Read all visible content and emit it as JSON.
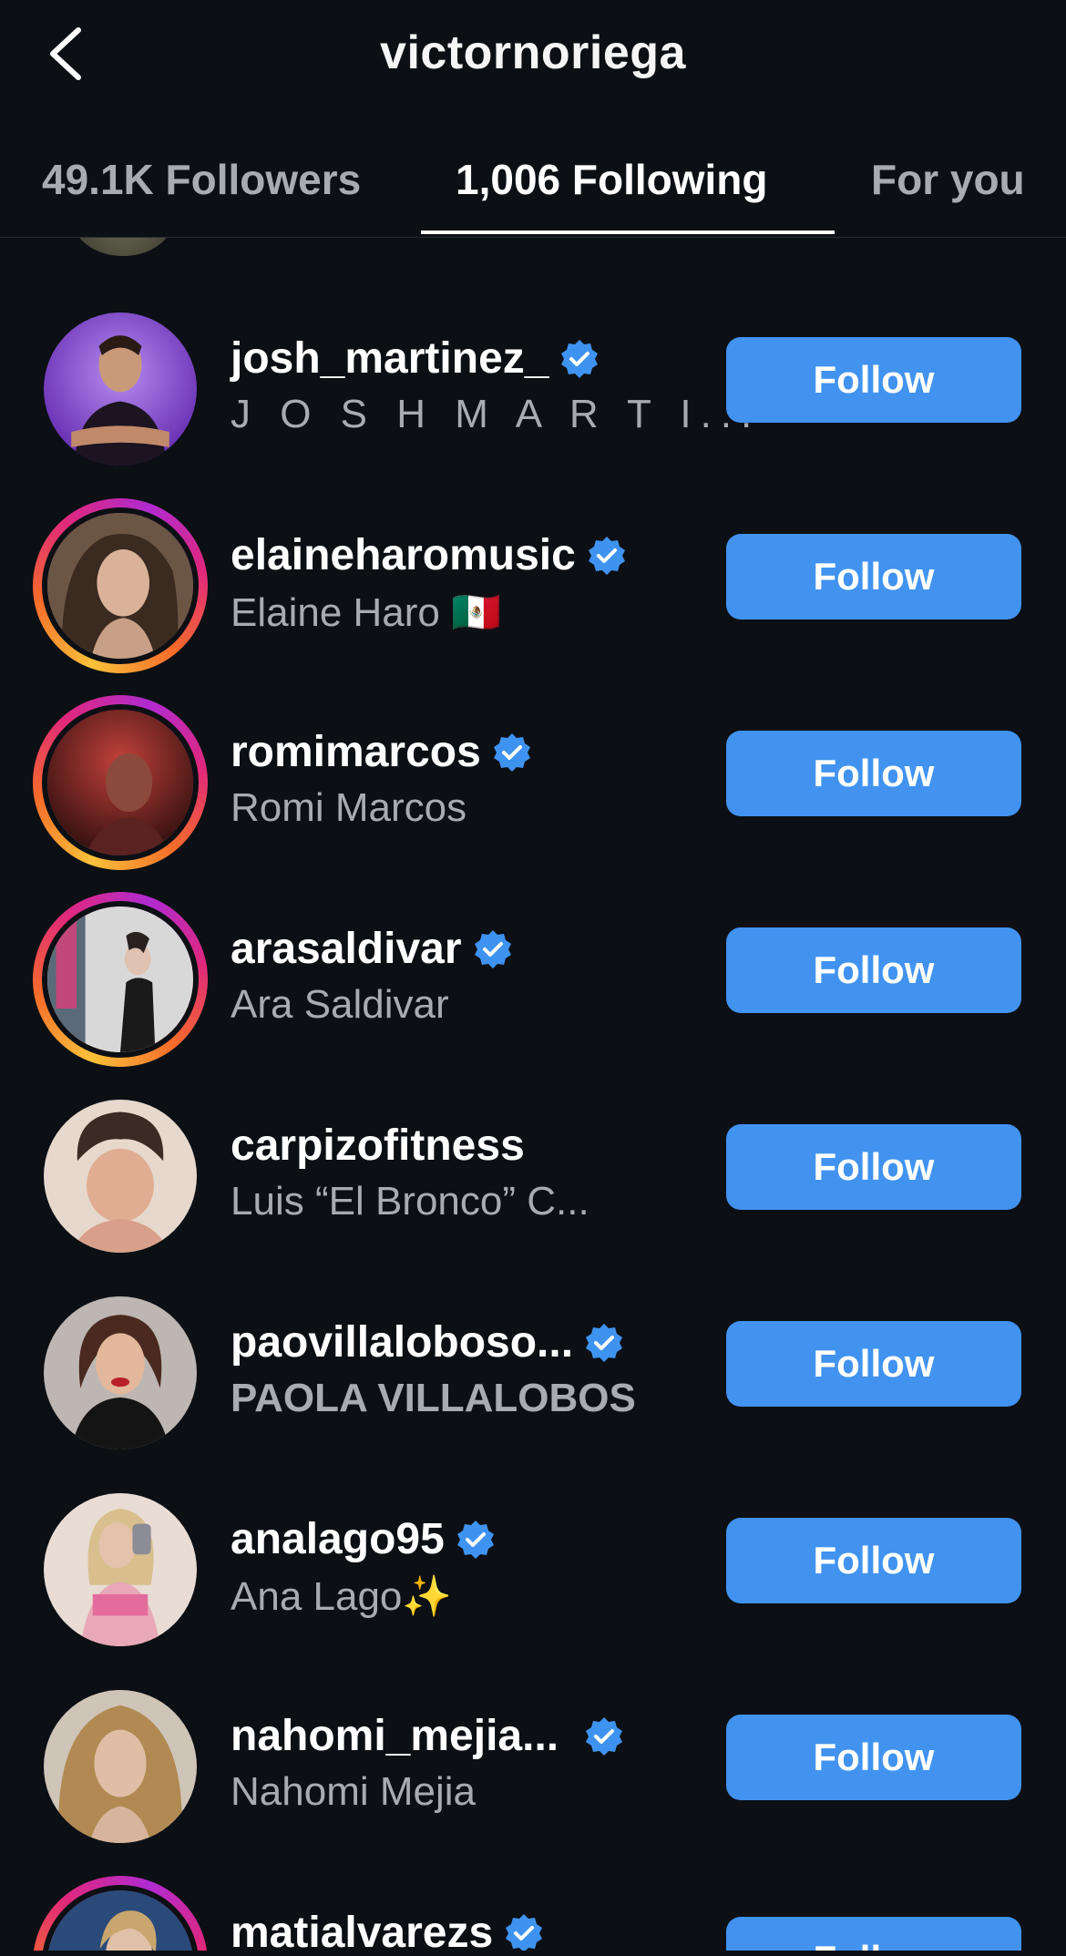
{
  "header": {
    "title": "victornoriega",
    "back_icon": "chevron-left-icon"
  },
  "tabs": [
    {
      "label": "49.1K Followers",
      "active": false
    },
    {
      "label": "1,006 Following",
      "active": true
    },
    {
      "label": "For you",
      "active": false
    }
  ],
  "colors": {
    "background": "#0c0f14",
    "button": "#4193ef",
    "verified": "#3f93f0",
    "secondary_text": "#a8abb1"
  },
  "users": [
    {
      "username": "josh_martinez_",
      "full_name": "J O S H  M A R T I...",
      "verified": true,
      "follow_label": "Follow"
    },
    {
      "username": "elaineharomusic",
      "full_name": "Elaine Haro 🇲🇽",
      "verified": true,
      "follow_label": "Follow"
    },
    {
      "username": "romimarcos",
      "full_name": "Romi Marcos",
      "verified": true,
      "follow_label": "Follow"
    },
    {
      "username": "arasaldivar",
      "full_name": "Ara Saldivar",
      "verified": true,
      "follow_label": "Follow"
    },
    {
      "username": "carpizofitness",
      "full_name": "Luis “El Bronco” C...",
      "verified": false,
      "follow_label": "Follow"
    },
    {
      "username": "paovillaloboso...",
      "full_name": "PAOLA VILLALOBOS",
      "verified": true,
      "follow_label": "Follow"
    },
    {
      "username": "analago95",
      "full_name": "Ana Lago✨",
      "verified": true,
      "follow_label": "Follow"
    },
    {
      "username": "nahomi_mejia...",
      "full_name": "Nahomi Mejia",
      "verified": true,
      "follow_label": "Follow"
    },
    {
      "username": "matialvarezs",
      "full_name": "",
      "verified": true,
      "follow_label": "Follow"
    }
  ]
}
